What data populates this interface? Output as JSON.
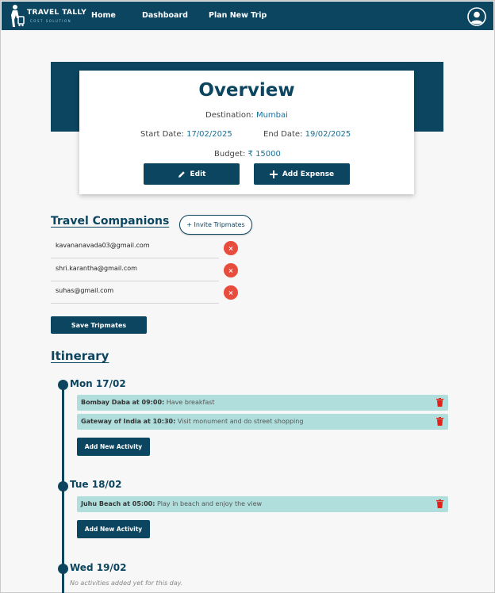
{
  "nav": {
    "logo_title": "TRAVEL TALLY",
    "logo_subtitle": "COST SOLUTION",
    "links": [
      "Home",
      "Dashboard",
      "Plan New Trip"
    ]
  },
  "overview": {
    "title": "Overview",
    "destination_label": "Destination:",
    "destination_value": "Mumbai",
    "start_label": "Start Date:",
    "start_value": "17/02/2025",
    "end_label": "End Date:",
    "end_value": "19/02/2025",
    "budget_label": "Budget:",
    "budget_value": "₹ 15000",
    "edit_label": "Edit",
    "add_expense_label": "Add Expense"
  },
  "companions": {
    "title": "Travel Companions",
    "invite_label": "+ Invite Tripmates",
    "emails": [
      "kavananavada03@gmail.com",
      "shri.karantha@gmail.com",
      "suhas@gmail.com"
    ],
    "remove_symbol": "×",
    "save_label": "Save Tripmates"
  },
  "itinerary": {
    "title": "Itinerary",
    "add_activity_label": "Add New Activity",
    "days": [
      {
        "label": "Mon 17/02",
        "activities": [
          {
            "place": "Bombay Daba",
            "time_text": "at 09:00:",
            "desc": "Have breakfast"
          },
          {
            "place": "Gateway of India",
            "time_text": "at 10:30:",
            "desc": "Visit monument and do street shopping"
          }
        ]
      },
      {
        "label": "Tue 18/02",
        "activities": [
          {
            "place": "Juhu Beach",
            "time_text": "at 05:00:",
            "desc": "Play in beach and enjoy the view"
          }
        ]
      },
      {
        "label": "Wed 19/02",
        "empty_text": "No activities added yet for this day."
      }
    ]
  },
  "colors": {
    "primary": "#0b4560",
    "accent_text": "#1b6f95",
    "activity_bg": "#afdedc",
    "danger": "#e74c3c",
    "trash": "#e0221a"
  }
}
